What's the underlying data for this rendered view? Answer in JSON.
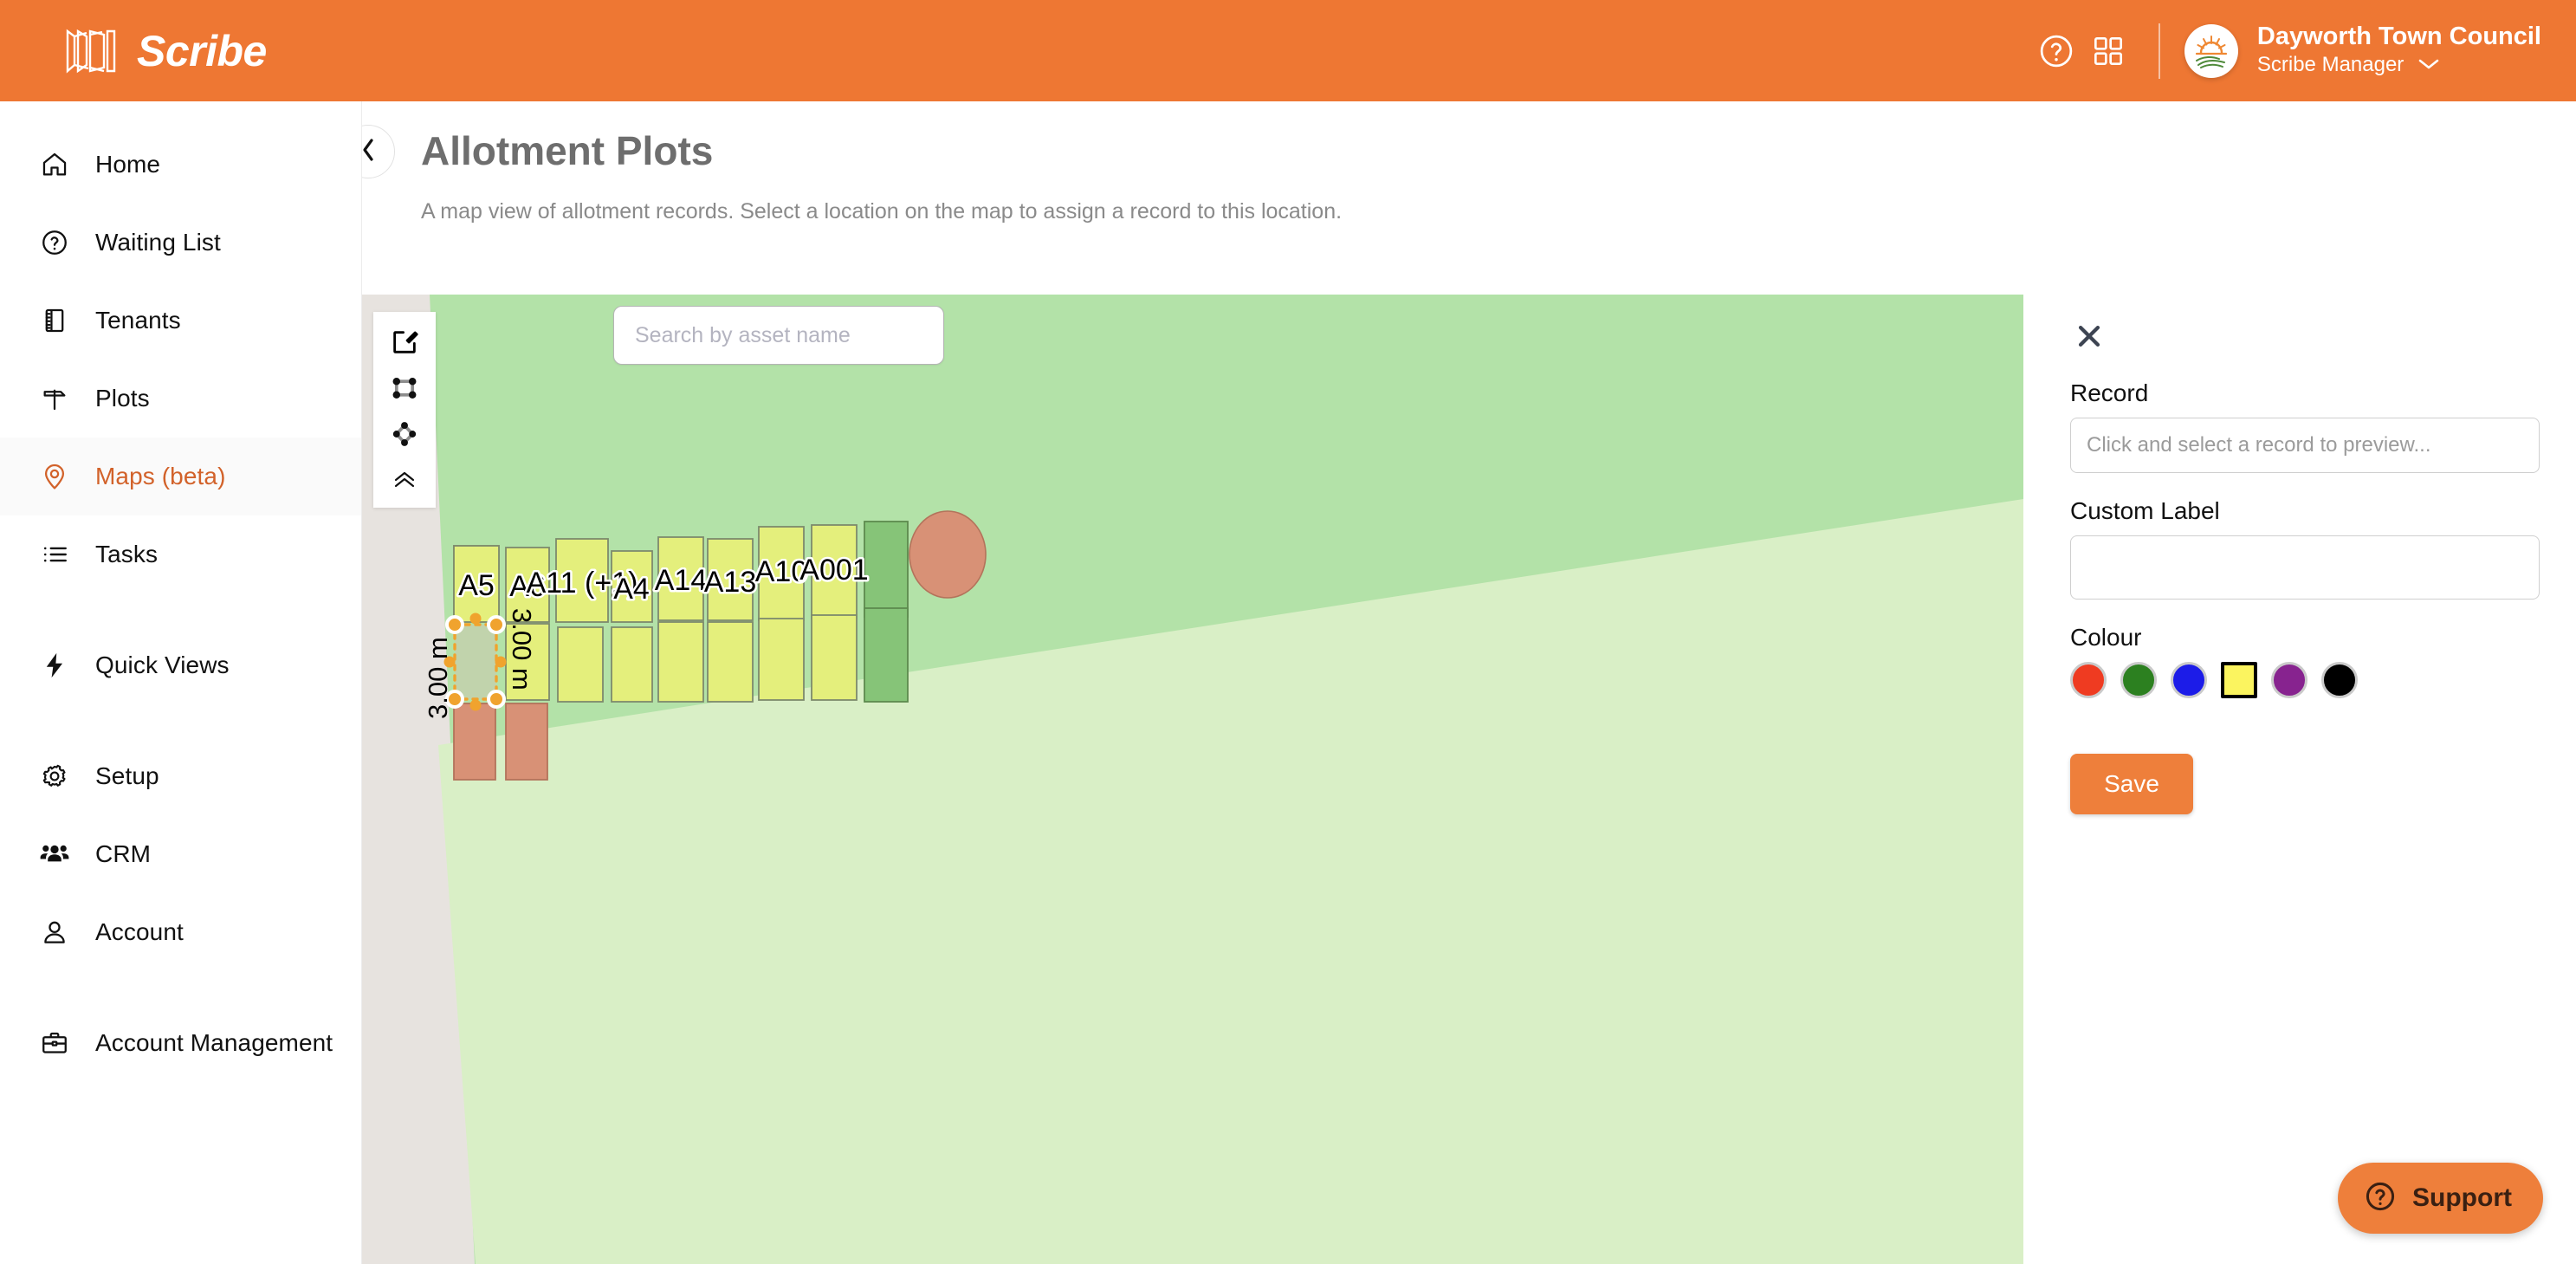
{
  "topbar": {
    "brand_name": "Scribe",
    "brand_icon": "scribe-book-logo",
    "help_icon": "help-circle-icon",
    "apps_icon": "grid-apps-icon",
    "avatar_icon": "sunrise-field-logo",
    "org_name": "Dayworth Town Council",
    "role_name": "Scribe Manager",
    "role_chevron_icon": "chevron-down-icon"
  },
  "sidebar": {
    "items": [
      {
        "label": "Home",
        "icon": "home-icon",
        "active": false
      },
      {
        "label": "Waiting List",
        "icon": "question-circle-icon",
        "active": false
      },
      {
        "label": "Tenants",
        "icon": "notebook-icon",
        "active": false
      },
      {
        "label": "Plots",
        "icon": "signpost-icon",
        "active": false
      },
      {
        "label": "Maps (beta)",
        "icon": "map-pin-icon",
        "active": true
      },
      {
        "label": "Tasks",
        "icon": "list-icon",
        "active": false
      },
      {
        "label": "Quick Views",
        "icon": "lightning-bolt-icon",
        "active": false
      },
      {
        "label": "Setup",
        "icon": "gear-icon",
        "active": false
      },
      {
        "label": "CRM",
        "icon": "people-group-icon",
        "active": false
      },
      {
        "label": "Account",
        "icon": "person-icon",
        "active": false
      },
      {
        "label": "Account Management",
        "icon": "briefcase-icon",
        "active": false
      }
    ]
  },
  "page": {
    "back_icon": "chevron-left-icon",
    "title": "Allotment Plots",
    "subtitle": "A map view of allotment records. Select a location on the map to assign a record to this location."
  },
  "map": {
    "toolbar": [
      {
        "name": "edit-pencil-tool",
        "icon": "edit-square-pencil-icon",
        "active": true
      },
      {
        "name": "draw-rectangle-tool",
        "icon": "rectangle-vertices-icon",
        "active": false
      },
      {
        "name": "draw-polygon-tool",
        "icon": "polygon-vertices-icon",
        "active": false
      },
      {
        "name": "collapse-toolbar",
        "icon": "chevron-double-up-icon",
        "active": false
      }
    ],
    "search_placeholder": "Search by asset name",
    "search_value": "",
    "colors": {
      "canvas_background": "#e7e3df",
      "field_dark": "#b3e2a8",
      "field_light": "#d9efc6",
      "plot_yellow": "#e4ef7c",
      "plot_green": "#86c478",
      "plot_salmon": "#d89176",
      "selection_orange": "#f0a32e"
    },
    "plot_labels": [
      "A5",
      "A6",
      "A11 (+1)",
      "A4",
      "A14",
      "A13",
      "A10",
      "A001"
    ],
    "selection": {
      "dimension_left": "3.00 m",
      "dimension_right": "3.00 m"
    }
  },
  "panel": {
    "close_icon": "close-x-icon",
    "record_label": "Record",
    "record_placeholder": "Click and select a record to preview...",
    "record_value": "",
    "custom_label_label": "Custom Label",
    "custom_label_placeholder": "",
    "custom_label_value": "",
    "colour_label": "Colour",
    "swatches": [
      {
        "name": "colour-red",
        "hex": "#ef3b21",
        "selected": false
      },
      {
        "name": "colour-green",
        "hex": "#2c8020",
        "selected": false
      },
      {
        "name": "colour-blue",
        "hex": "#1c1ce8",
        "selected": false
      },
      {
        "name": "colour-yellow",
        "hex": "#fbf45f",
        "selected": true
      },
      {
        "name": "colour-purple",
        "hex": "#87238f",
        "selected": false
      },
      {
        "name": "colour-black",
        "hex": "#000000",
        "selected": false
      }
    ],
    "save_label": "Save"
  },
  "support": {
    "icon": "question-circle-icon",
    "label": "Support"
  }
}
